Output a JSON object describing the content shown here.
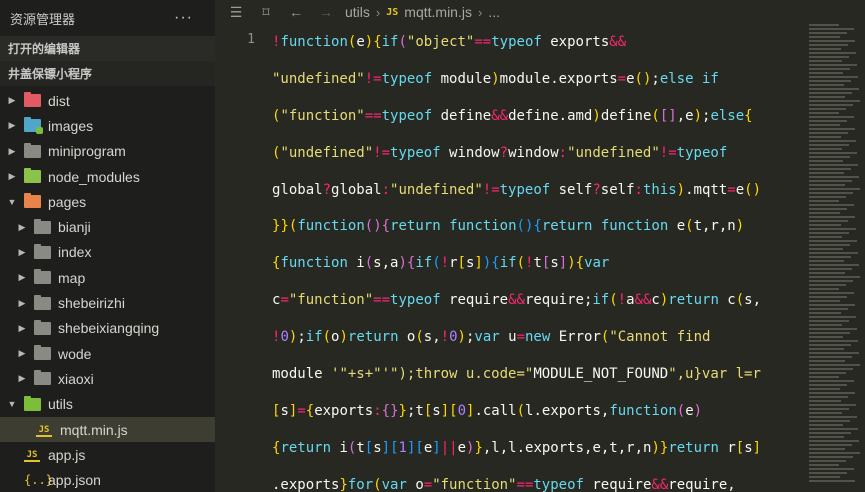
{
  "sidebar": {
    "title": "资源管理器",
    "more": "···",
    "open_editors": "打开的编辑器",
    "project": "井盖保镖小程序",
    "items": [
      {
        "label": "dist",
        "icon": "folder-red-icon"
      },
      {
        "label": "images",
        "icon": "folder-images-icon"
      },
      {
        "label": "miniprogram",
        "icon": "folder-icon"
      },
      {
        "label": "node_modules",
        "icon": "folder-node-icon"
      },
      {
        "label": "pages",
        "icon": "folder-pages-icon"
      },
      {
        "label": "bianji",
        "icon": "folder-icon"
      },
      {
        "label": "index",
        "icon": "folder-icon"
      },
      {
        "label": "map",
        "icon": "folder-icon"
      },
      {
        "label": "shebeirizhi",
        "icon": "folder-icon"
      },
      {
        "label": "shebeixiangqing",
        "icon": "folder-icon"
      },
      {
        "label": "wode",
        "icon": "folder-icon"
      },
      {
        "label": "xiaoxi",
        "icon": "folder-icon"
      },
      {
        "label": "utils",
        "icon": "folder-utils-icon"
      },
      {
        "label": "mqtt.min.js",
        "icon": "js-file-icon"
      },
      {
        "label": "app.js",
        "icon": "js-file-icon"
      },
      {
        "label": "app.json",
        "icon": "json-file-icon"
      }
    ]
  },
  "editor": {
    "breadcrumb": [
      "utils",
      "mqtt.min.js",
      "..."
    ],
    "js_badge": "JS",
    "line_number": "1",
    "code_lines": [
      "!function(e){if(\"object\"==typeof exports&&",
      "\"undefined\"!=typeof module)module.exports=e();else if",
      "(\"function\"==typeof define&&define.amd)define([],e);else{",
      "(\"undefined\"!=typeof window?window:\"undefined\"!=typeof",
      "global?global:\"undefined\"!=typeof self?self:this).mqtt=e()",
      "}}(function(){return function(){return function e(t,r,n)",
      "{function i(s,a){if(!r[s]){if(!t[s]){var",
      "c=\"function\"==typeof require&&require;if(!a&&c)return c(s,",
      "!0);if(o)return o(s,!0);var u=new Error(\"Cannot find",
      "module '\"+s+\"'\");throw u.code=\"MODULE_NOT_FOUND\",u}var l=r",
      "[s]={exports:{}};t[s][0].call(l.exports,function(e)",
      "{return i(t[s][1][e]||e)},l,l.exports,e,t,r,n)}return r[s]",
      ".exports}for(var o=\"function\"==typeof require&&require,"
    ]
  },
  "colors": {
    "sidebar_bg": "#1e1f1c",
    "editor_bg": "#272822",
    "active_row": "#3e3d32",
    "string": "#e6db74",
    "keyword": "#66d9ef",
    "number": "#ae81ff"
  }
}
